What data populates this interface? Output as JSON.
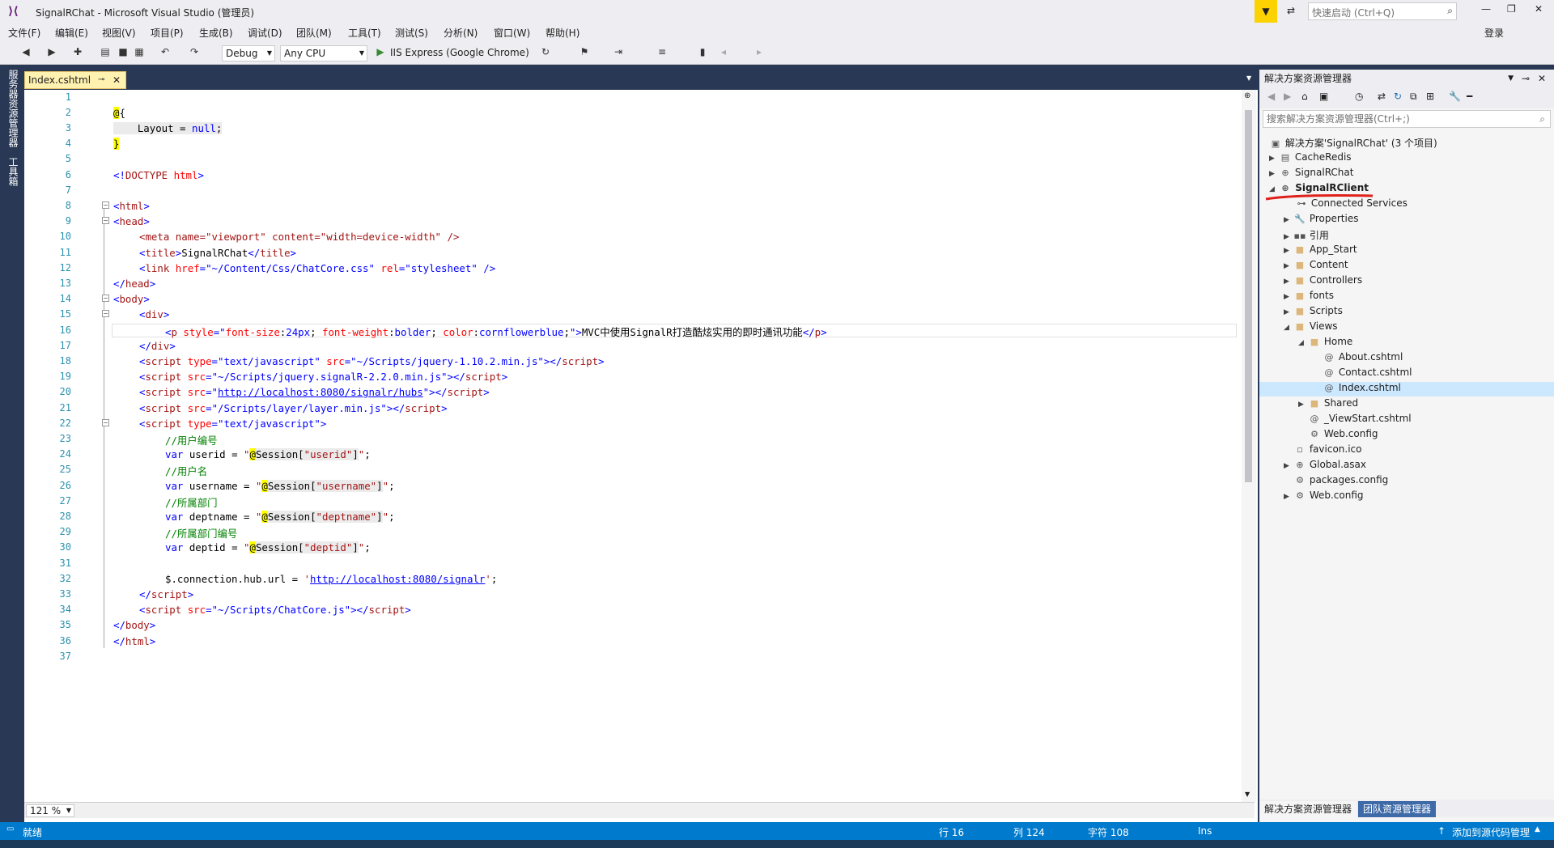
{
  "window": {
    "title": "SignalRChat - Microsoft Visual Studio (管理员)",
    "quick_launch_placeholder": "快速启动 (Ctrl+Q)",
    "login": "登录"
  },
  "menu": [
    "文件(F)",
    "编辑(E)",
    "视图(V)",
    "项目(P)",
    "生成(B)",
    "调试(D)",
    "团队(M)",
    "工具(T)",
    "测试(S)",
    "分析(N)",
    "窗口(W)",
    "帮助(H)"
  ],
  "toolbar": {
    "config": "Debug",
    "platform": "Any CPU",
    "run_target": "IIS Express (Google Chrome)"
  },
  "left_tabs": [
    "服务器资源管理器",
    "工具箱"
  ],
  "editor": {
    "tab_name": "Index.cshtml",
    "zoom": "121 %",
    "line_numbers": [
      "1",
      "2",
      "3",
      "4",
      "5",
      "6",
      "7",
      "8",
      "9",
      "10",
      "11",
      "12",
      "13",
      "14",
      "15",
      "16",
      "17",
      "18",
      "19",
      "20",
      "21",
      "22",
      "23",
      "24",
      "25",
      "26",
      "27",
      "28",
      "29",
      "30",
      "31",
      "32",
      "33",
      "34",
      "35",
      "36",
      "37"
    ],
    "lines": {
      "l10_meta": "<meta name=\"viewport\" content=\"width=device-width\" />",
      "l16_text": "MVC中使用SignalR打造酷炫实用的即时通讯功能",
      "l18_src": "\"~/Scripts/jquery-1.10.2.min.js\"",
      "l19_src": "\"~/Scripts/jquery.signalR-2.2.0.min.js\"",
      "l20_src": "http://localhost:8080/signalr/hubs",
      "l21_src": "\"/Scripts/layer/layer.min.js\"",
      "c24": "//用户编号",
      "c26": "//用户名",
      "c28": "//所属部门",
      "c30": "//所属部门编号",
      "l32_url": "http://localhost:8080/signalr",
      "l34_src": "\"~/Scripts/ChatCore.js\""
    }
  },
  "solution_explorer": {
    "title": "解决方案资源管理器",
    "search_placeholder": "搜索解决方案资源管理器(Ctrl+;)",
    "items": [
      "解决方案'SignalRChat' (3 个项目)",
      "CacheRedis",
      "SignalRChat",
      "SignalRClient",
      "Connected Services",
      "Properties",
      "引用",
      "App_Start",
      "Content",
      "Controllers",
      "fonts",
      "Scripts",
      "Views",
      "Home",
      "About.cshtml",
      "Contact.cshtml",
      "Index.cshtml",
      "Shared",
      "_ViewStart.cshtml",
      "Web.config",
      "favicon.ico",
      "Global.asax",
      "packages.config",
      "Web.config"
    ],
    "bottom_tabs": [
      "解决方案资源管理器",
      "团队资源管理器"
    ]
  },
  "status": {
    "ready": "就绪",
    "line": "行 16",
    "col": "列 124",
    "char": "字符 108",
    "mode": "Ins",
    "source_control": "添加到源代码管理"
  }
}
